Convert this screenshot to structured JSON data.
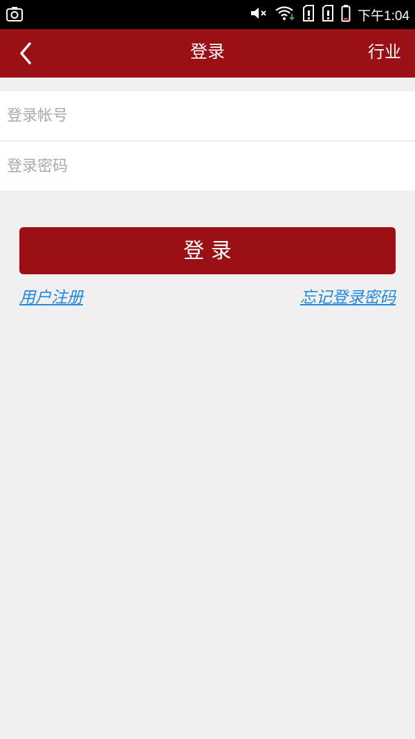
{
  "status_bar": {
    "time": "下午1:04",
    "icons": [
      "screenshot-icon",
      "mute-icon",
      "wifi-icon",
      "sim-card-icon",
      "sim-card-icon",
      "battery-icon"
    ]
  },
  "header": {
    "title": "登录",
    "action": "行业"
  },
  "form": {
    "account_placeholder": "登录帐号",
    "password_placeholder": "登录密码",
    "submit_label": "登 录"
  },
  "links": {
    "register": "用户注册",
    "forgot_password": "忘记登录密码"
  },
  "colors": {
    "brand": "#9a1014",
    "background": "#f0f0f0",
    "link": "#1e88e5"
  }
}
